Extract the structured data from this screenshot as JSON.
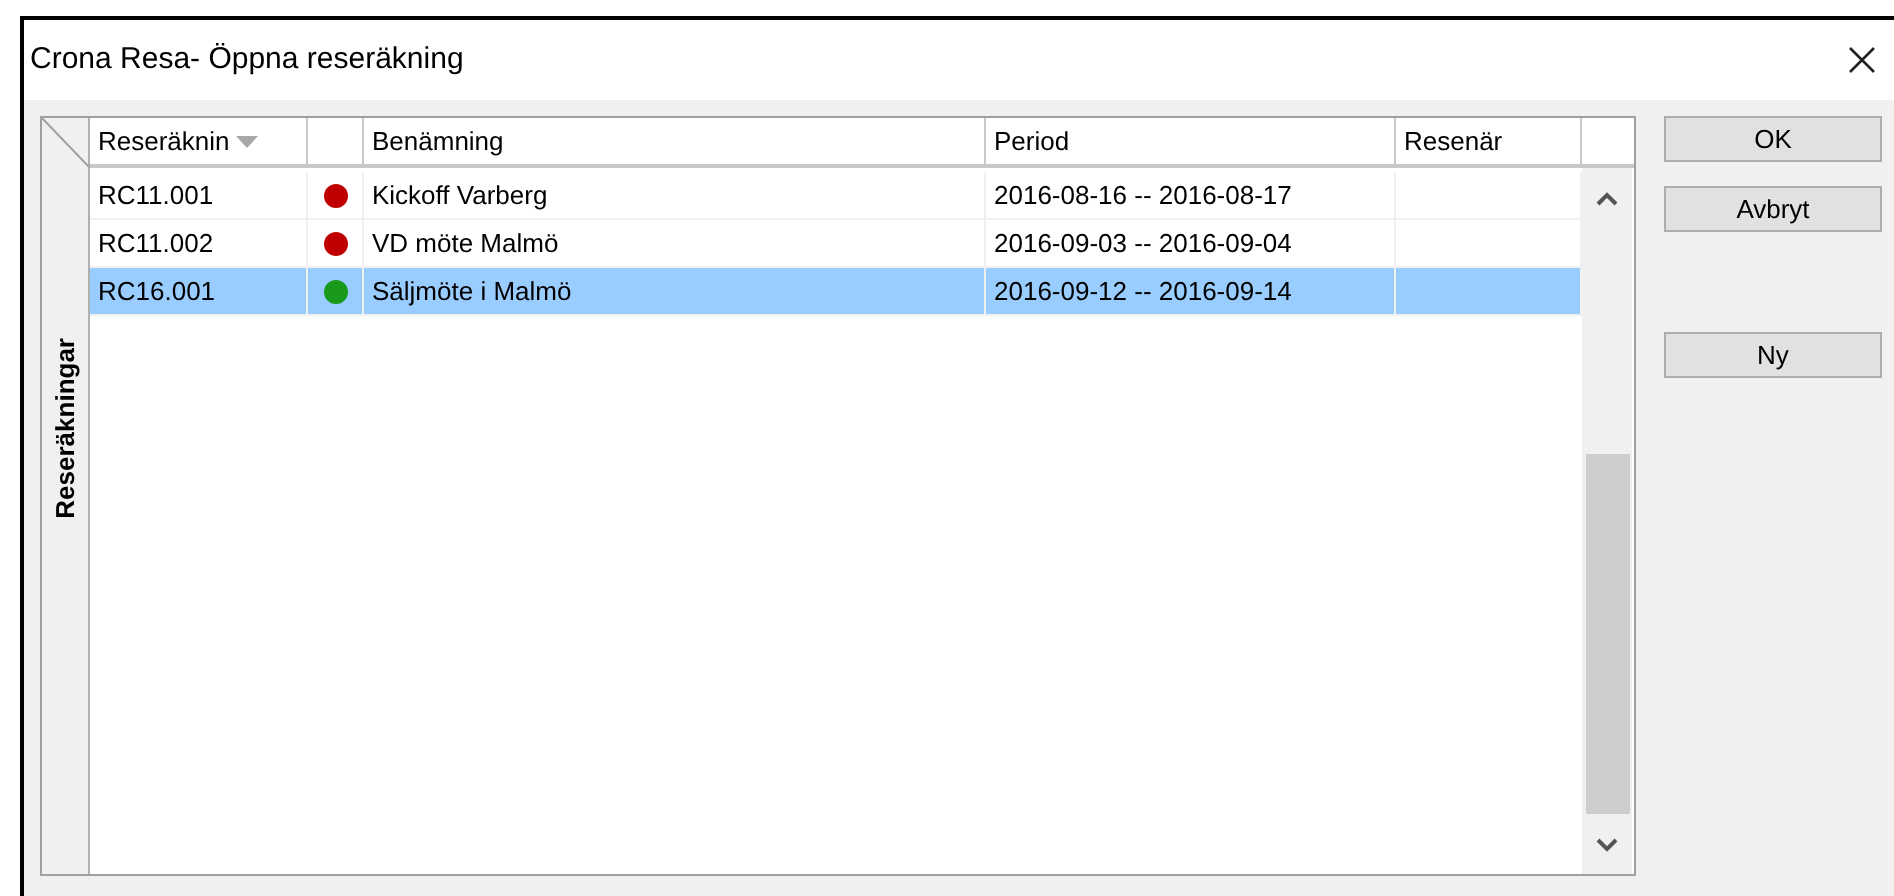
{
  "window": {
    "title": "Crona Resa- Öppna reseräkning"
  },
  "side_tab": {
    "label": "Reseräkningar"
  },
  "table": {
    "columns": [
      {
        "label": "Reseräknin",
        "sorted": true
      },
      {
        "sorted": false
      },
      {
        "label": "Benämning",
        "sorted": false
      },
      {
        "label": "Period",
        "sorted": false
      },
      {
        "label": "Resenär",
        "sorted": false
      }
    ],
    "rows": [
      {
        "number": "RC11.001",
        "color": "#c00000",
        "name": "Kickoff Varberg",
        "period": "2016-08-16 -- 2016-08-17",
        "selected": false
      },
      {
        "number": "RC11.002",
        "color": "#c00000",
        "name": "VD möte Malmö",
        "period": "2016-09-03 -- 2016-09-04",
        "selected": false
      },
      {
        "number": "RC16.001",
        "color": "#1a9a1a",
        "name": "Säljmöte i Malmö",
        "period": "2016-09-12 -- 2016-09-14",
        "selected": true
      }
    ]
  },
  "buttons": [
    {
      "label": "OK"
    },
    {
      "label": "Avbryt"
    },
    {
      "label": "Ny"
    }
  ]
}
